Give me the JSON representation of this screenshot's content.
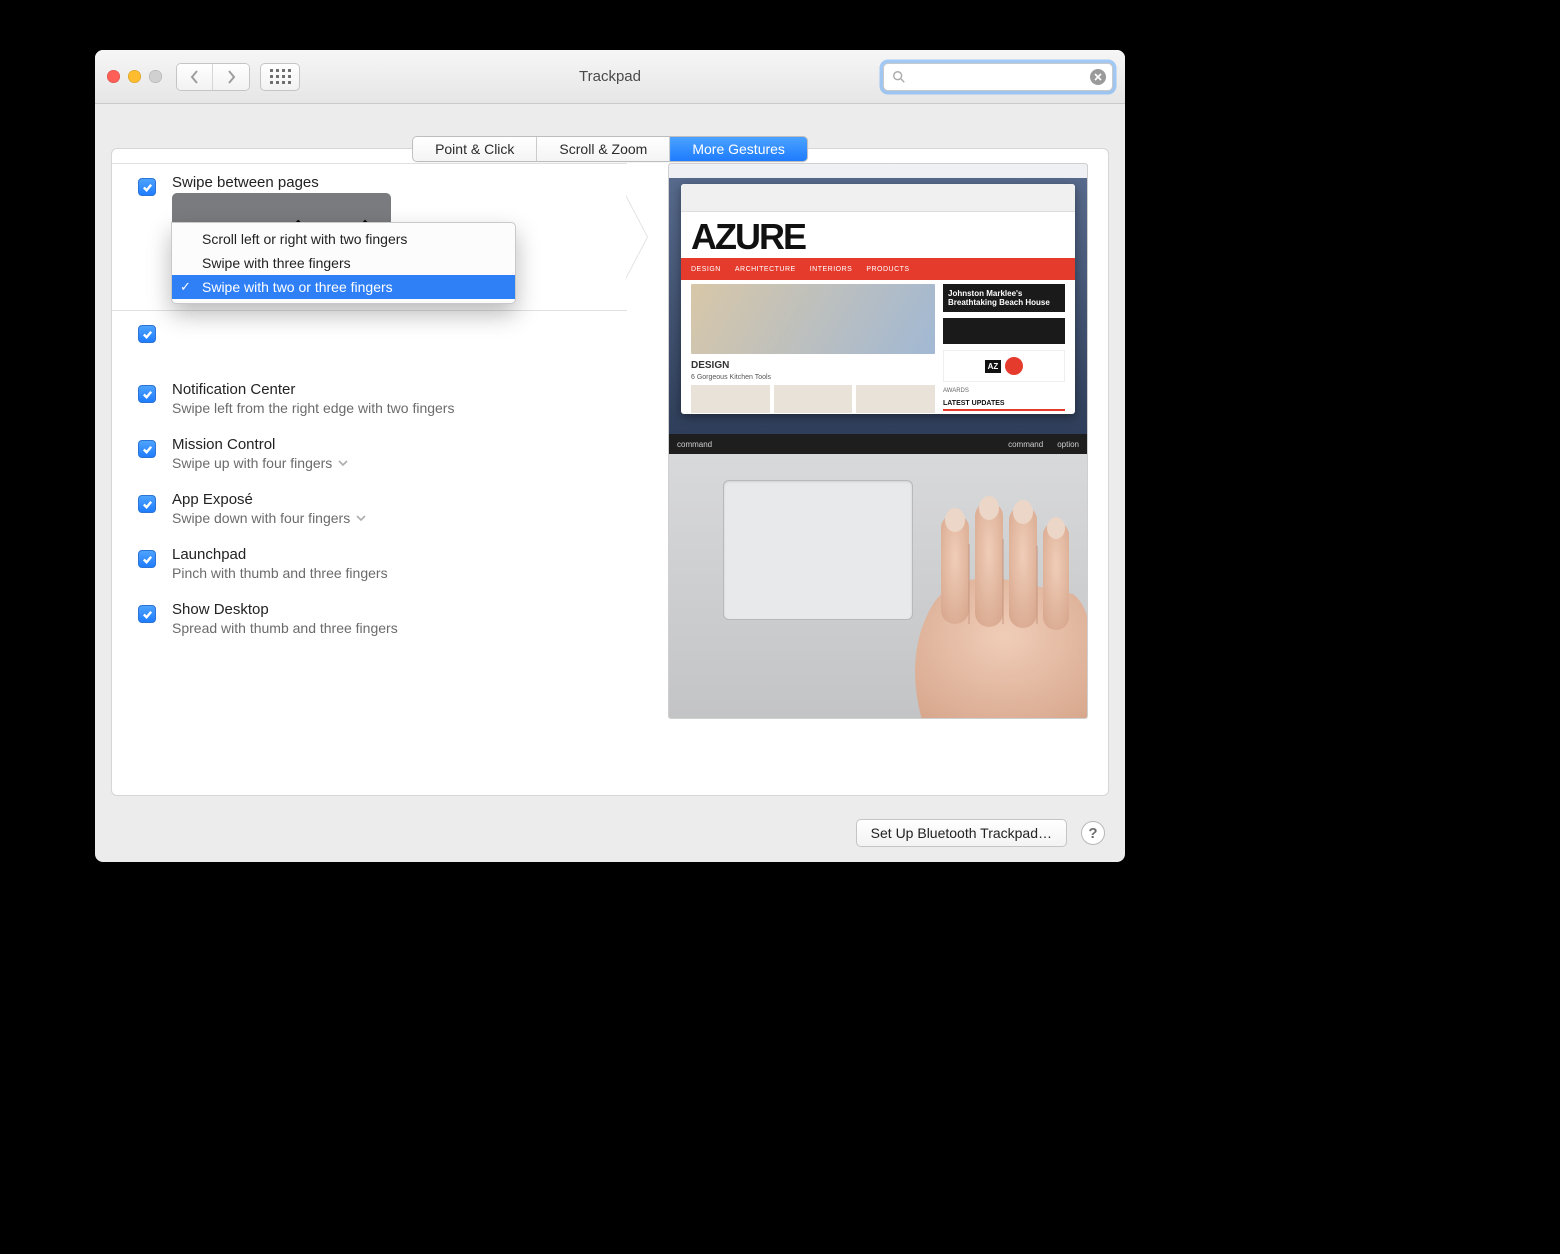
{
  "window": {
    "title": "Trackpad"
  },
  "tabs": [
    {
      "label": "Point & Click",
      "active": false
    },
    {
      "label": "Scroll & Zoom",
      "active": false
    },
    {
      "label": "More Gestures",
      "active": true
    }
  ],
  "gestures": [
    {
      "title": "Swipe between pages",
      "selected_option": "Swipe with two or three fingers",
      "has_dropdown": true,
      "dropdown_open": true,
      "options": [
        "Scroll left or right with two fingers",
        "Swipe with three fingers",
        "Swipe with two or three fingers"
      ],
      "checked": true
    },
    {
      "title": "",
      "subtitle": "",
      "checked": true
    },
    {
      "title": "Notification Center",
      "subtitle": "Swipe left from the right edge with two fingers",
      "checked": true
    },
    {
      "title": "Mission Control",
      "subtitle": "Swipe up with four fingers",
      "has_dropdown": true,
      "checked": true
    },
    {
      "title": "App Exposé",
      "subtitle": "Swipe down with four fingers",
      "has_dropdown": true,
      "checked": true
    },
    {
      "title": "Launchpad",
      "subtitle": "Pinch with thumb and three fingers",
      "checked": true
    },
    {
      "title": "Show Desktop",
      "subtitle": "Spread with thumb and three fingers",
      "checked": true
    }
  ],
  "preview": {
    "logo": "AZURE",
    "redbar_items": [
      "DESIGN",
      "ARCHITECTURE",
      "INTERIORS",
      "PRODUCTS"
    ],
    "side_headline": "Johnston Marklee's Breathtaking Beach House",
    "design_label": "DESIGN",
    "kitchen_label": "6 Gorgeous Kitchen Tools",
    "az": "AZ",
    "awards": "AWARDS",
    "latest": "LATEST UPDATES",
    "key_left": "command",
    "key_right1": "command",
    "key_right2": "option"
  },
  "footer": {
    "setup_label": "Set Up Bluetooth Trackpad…",
    "help_label": "?"
  },
  "search": {
    "placeholder": ""
  }
}
